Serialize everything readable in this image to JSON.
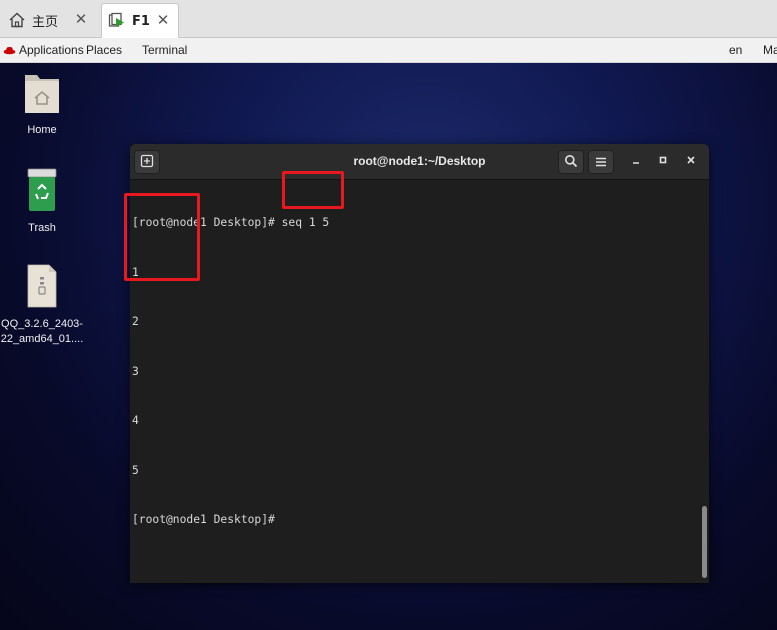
{
  "tabs": [
    {
      "label": "主页",
      "icon": "home-icon",
      "active": false
    },
    {
      "label": "F1",
      "icon": "vm-play-icon",
      "active": true
    }
  ],
  "gnome_bar": {
    "applications": "Applications",
    "places": "Places",
    "terminal": "Terminal",
    "lang": "en",
    "time": "Ma"
  },
  "desktop_icons": [
    {
      "label": "Home",
      "icon": "folder-home-icon"
    },
    {
      "label": "Trash",
      "icon": "trash-icon"
    },
    {
      "label": "QQ_3.2.6_2403-22_amd64_01....",
      "icon": "package-file-icon"
    }
  ],
  "terminal": {
    "title": "root@node1:~/Desktop",
    "lines": [
      "[root@node1 Desktop]# seq 1 5",
      "1",
      "2",
      "3",
      "4",
      "5",
      "[root@node1 Desktop]# "
    ]
  },
  "colors": {
    "annotation": "#e8181e",
    "terminal_bg": "#1e1e1e",
    "header_bg": "#2b2b2b"
  }
}
